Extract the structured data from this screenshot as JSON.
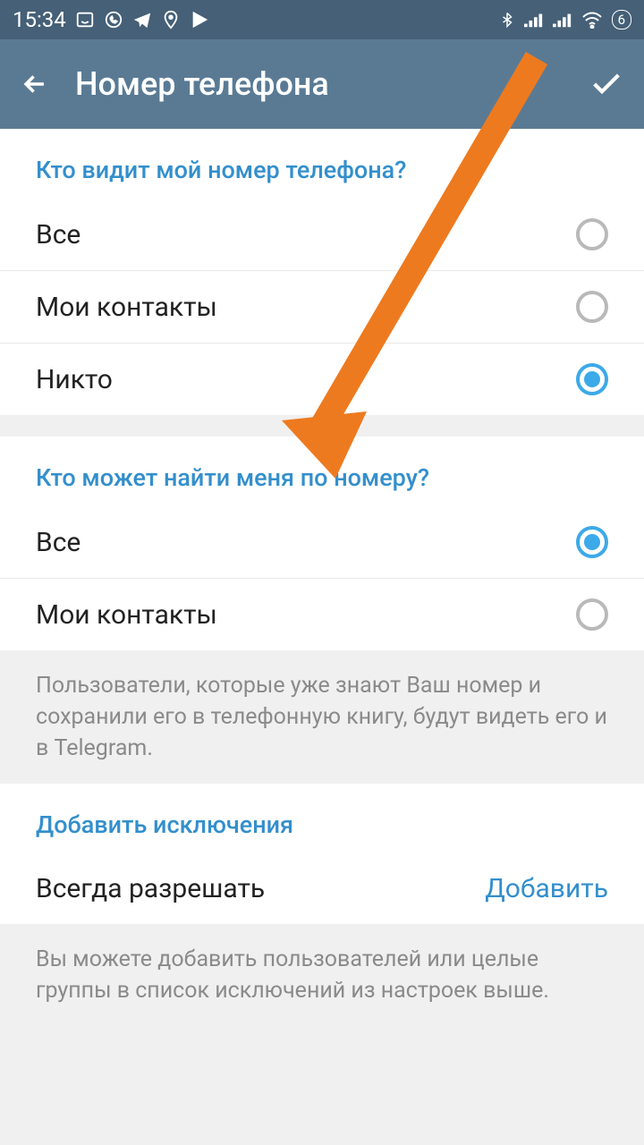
{
  "status": {
    "time": "15:34",
    "battery": "6"
  },
  "header": {
    "title": "Номер телефона"
  },
  "section1": {
    "title": "Кто видит мой номер телефона?",
    "options": [
      {
        "label": "Все",
        "selected": false
      },
      {
        "label": "Мои контакты",
        "selected": false
      },
      {
        "label": "Никто",
        "selected": true
      }
    ]
  },
  "section2": {
    "title": "Кто может найти меня по номеру?",
    "options": [
      {
        "label": "Все",
        "selected": true
      },
      {
        "label": "Мои контакты",
        "selected": false
      }
    ],
    "info": "Пользователи, которые уже знают Ваш номер и сохранили его в телефонную книгу, будут видеть его и в Telegram."
  },
  "section3": {
    "title": "Добавить исключения",
    "action_label": "Всегда разрешать",
    "action_link": "Добавить",
    "info": "Вы можете добавить пользователей или целые группы в список исключений из настроек выше."
  }
}
